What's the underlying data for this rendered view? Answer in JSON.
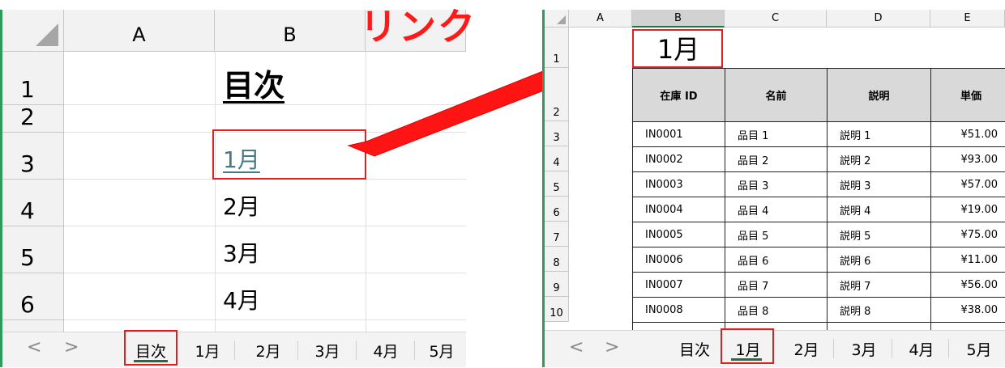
{
  "left_sheet": {
    "columns": [
      "A",
      "B"
    ],
    "rows": [
      "1",
      "2",
      "3",
      "4",
      "5",
      "6"
    ],
    "cells": {
      "title": "目次",
      "link": "1月",
      "month2": "2月",
      "month3": "3月",
      "month4": "4月"
    },
    "tabs": [
      "目次",
      "1月",
      "2月",
      "3月",
      "4月",
      "5月"
    ],
    "active_tab": "目次",
    "nav_prev": "<",
    "nav_next": ">"
  },
  "annotation": {
    "label": "リンク",
    "color": "#ff1a1a"
  },
  "right_sheet": {
    "columns": [
      "A",
      "B",
      "C",
      "D",
      "E"
    ],
    "rows": [
      "1",
      "2",
      "3",
      "4",
      "5",
      "6",
      "7",
      "8",
      "9",
      "10"
    ],
    "title": "1月",
    "table_headers": [
      "在庫 ID",
      "名前",
      "説明",
      "単価"
    ],
    "table_rows": [
      [
        "IN0001",
        "品目 1",
        "説明 1",
        "¥51.00"
      ],
      [
        "IN0002",
        "品目 2",
        "説明 2",
        "¥93.00"
      ],
      [
        "IN0003",
        "品目 3",
        "説明 3",
        "¥57.00"
      ],
      [
        "IN0004",
        "品目 4",
        "説明 4",
        "¥19.00"
      ],
      [
        "IN0005",
        "品目 5",
        "説明 5",
        "¥75.00"
      ],
      [
        "IN0006",
        "品目 6",
        "説明 6",
        "¥11.00"
      ],
      [
        "IN0007",
        "品目 7",
        "説明 7",
        "¥56.00"
      ],
      [
        "IN0008",
        "品目 8",
        "説明 8",
        "¥38.00"
      ]
    ],
    "tabs": [
      "目次",
      "1月",
      "2月",
      "3月",
      "4月",
      "5月"
    ],
    "active_tab": "1月",
    "nav_prev": "<",
    "nav_next": ">"
  },
  "colors": {
    "sheet_green": "#217346",
    "highlight_red": "#e02020",
    "link_color": "#467886",
    "header_fill": "#d9d9d9"
  }
}
